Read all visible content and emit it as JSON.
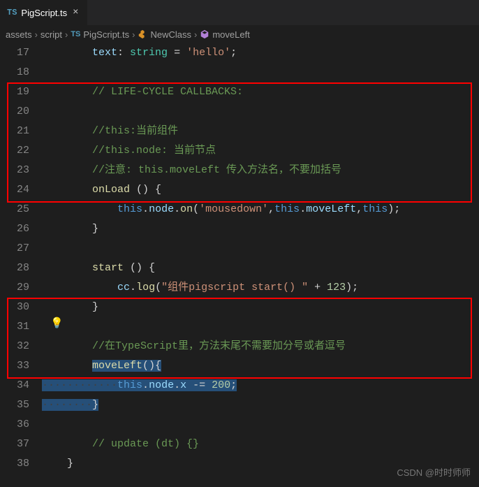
{
  "tab": {
    "icon_label": "TS",
    "filename": "PigScript.ts",
    "close_glyph": "×"
  },
  "breadcrumbs": {
    "sep": "›",
    "items": [
      "assets",
      "script"
    ],
    "file_icon": "TS",
    "file": "PigScript.ts",
    "class": "NewClass",
    "method": "moveLeft"
  },
  "bulb_glyph": "💡",
  "watermark": "CSDN @时时师师",
  "lines": {
    "17": {
      "num": "17",
      "tokens": [
        {
          "t": "        ",
          "c": ""
        },
        {
          "t": "text",
          "c": "tok-var"
        },
        {
          "t": ": ",
          "c": "tok-punc"
        },
        {
          "t": "string",
          "c": "tok-type"
        },
        {
          "t": " = ",
          "c": "tok-op"
        },
        {
          "t": "'hello'",
          "c": "tok-str"
        },
        {
          "t": ";",
          "c": "tok-punc"
        }
      ]
    },
    "18": {
      "num": "18",
      "tokens": []
    },
    "19": {
      "num": "19",
      "tokens": [
        {
          "t": "        ",
          "c": ""
        },
        {
          "t": "// LIFE-CYCLE CALLBACKS:",
          "c": "tok-comment"
        }
      ]
    },
    "20": {
      "num": "20",
      "tokens": []
    },
    "21": {
      "num": "21",
      "tokens": [
        {
          "t": "        ",
          "c": ""
        },
        {
          "t": "//this:当前组件",
          "c": "tok-comment"
        }
      ]
    },
    "22": {
      "num": "22",
      "tokens": [
        {
          "t": "        ",
          "c": ""
        },
        {
          "t": "//this.node: 当前节点",
          "c": "tok-comment"
        }
      ]
    },
    "23": {
      "num": "23",
      "tokens": [
        {
          "t": "        ",
          "c": ""
        },
        {
          "t": "//注意: this.moveLeft 传入方法名，不要加括号",
          "c": "tok-comment"
        }
      ]
    },
    "24": {
      "num": "24",
      "tokens": [
        {
          "t": "        ",
          "c": ""
        },
        {
          "t": "onLoad",
          "c": "tok-fn"
        },
        {
          "t": " () {",
          "c": "tok-punc"
        }
      ]
    },
    "25": {
      "num": "25",
      "tokens": [
        {
          "t": "            ",
          "c": ""
        },
        {
          "t": "this",
          "c": "tok-kw"
        },
        {
          "t": ".",
          "c": "tok-punc"
        },
        {
          "t": "node",
          "c": "tok-var"
        },
        {
          "t": ".",
          "c": "tok-punc"
        },
        {
          "t": "on",
          "c": "tok-fn"
        },
        {
          "t": "(",
          "c": "tok-punc"
        },
        {
          "t": "'mousedown'",
          "c": "tok-str"
        },
        {
          "t": ",",
          "c": "tok-punc"
        },
        {
          "t": "this",
          "c": "tok-kw"
        },
        {
          "t": ".",
          "c": "tok-punc"
        },
        {
          "t": "moveLeft",
          "c": "tok-var"
        },
        {
          "t": ",",
          "c": "tok-punc"
        },
        {
          "t": "this",
          "c": "tok-kw"
        },
        {
          "t": ");",
          "c": "tok-punc"
        }
      ]
    },
    "26": {
      "num": "26",
      "tokens": [
        {
          "t": "        ",
          "c": ""
        },
        {
          "t": "}",
          "c": "tok-punc"
        }
      ]
    },
    "27": {
      "num": "27",
      "tokens": []
    },
    "28": {
      "num": "28",
      "tokens": [
        {
          "t": "        ",
          "c": ""
        },
        {
          "t": "start",
          "c": "tok-fn"
        },
        {
          "t": " () {",
          "c": "tok-punc"
        }
      ]
    },
    "29": {
      "num": "29",
      "tokens": [
        {
          "t": "            ",
          "c": ""
        },
        {
          "t": "cc",
          "c": "tok-var"
        },
        {
          "t": ".",
          "c": "tok-punc"
        },
        {
          "t": "log",
          "c": "tok-fn"
        },
        {
          "t": "(",
          "c": "tok-punc"
        },
        {
          "t": "\"组件pigscript start() \"",
          "c": "tok-str"
        },
        {
          "t": " + ",
          "c": "tok-op"
        },
        {
          "t": "123",
          "c": "tok-num"
        },
        {
          "t": ");",
          "c": "tok-punc"
        }
      ]
    },
    "30": {
      "num": "30",
      "tokens": [
        {
          "t": "        ",
          "c": ""
        },
        {
          "t": "}",
          "c": "tok-punc"
        }
      ]
    },
    "31": {
      "num": "31",
      "tokens": []
    },
    "32": {
      "num": "32",
      "tokens": [
        {
          "t": "        ",
          "c": ""
        },
        {
          "t": "//在TypeScript里，方法末尾不需要加分号或者逗号",
          "c": "tok-comment"
        }
      ]
    },
    "33": {
      "num": "33",
      "tokens": [
        {
          "t": "        ",
          "c": ""
        },
        {
          "t": "moveLeft",
          "c": "tok-fn",
          "sel": true
        },
        {
          "t": "(){",
          "c": "tok-punc",
          "sel": true
        }
      ]
    },
    "34": {
      "num": "34",
      "tokens": [
        {
          "t": "········",
          "c": "ws-dot",
          "sel": true
        },
        {
          "t": "····",
          "c": "ws-dot",
          "sel": true
        },
        {
          "t": "this",
          "c": "tok-kw",
          "sel": true
        },
        {
          "t": ".",
          "c": "tok-punc",
          "sel": true
        },
        {
          "t": "node",
          "c": "tok-var",
          "sel": true
        },
        {
          "t": ".",
          "c": "tok-punc",
          "sel": true
        },
        {
          "t": "x",
          "c": "tok-var",
          "sel": true
        },
        {
          "t": " -= ",
          "c": "tok-op",
          "sel": true
        },
        {
          "t": "200",
          "c": "tok-num",
          "sel": true
        },
        {
          "t": ";",
          "c": "tok-punc",
          "sel": true
        }
      ]
    },
    "35": {
      "num": "35",
      "tokens": [
        {
          "t": "········",
          "c": "ws-dot",
          "sel": true
        },
        {
          "t": "}",
          "c": "tok-punc",
          "sel": true
        }
      ]
    },
    "36": {
      "num": "36",
      "tokens": []
    },
    "37": {
      "num": "37",
      "tokens": [
        {
          "t": "        ",
          "c": ""
        },
        {
          "t": "// update (dt) {}",
          "c": "tok-comment"
        }
      ]
    },
    "38": {
      "num": "38",
      "tokens": [
        {
          "t": "    ",
          "c": ""
        },
        {
          "t": "}",
          "c": "tok-punc"
        }
      ]
    }
  },
  "line_order": [
    "17",
    "18",
    "19",
    "20",
    "21",
    "22",
    "23",
    "24",
    "25",
    "26",
    "27",
    "28",
    "29",
    "30",
    "31",
    "32",
    "33",
    "34",
    "35",
    "36",
    "37",
    "38"
  ]
}
